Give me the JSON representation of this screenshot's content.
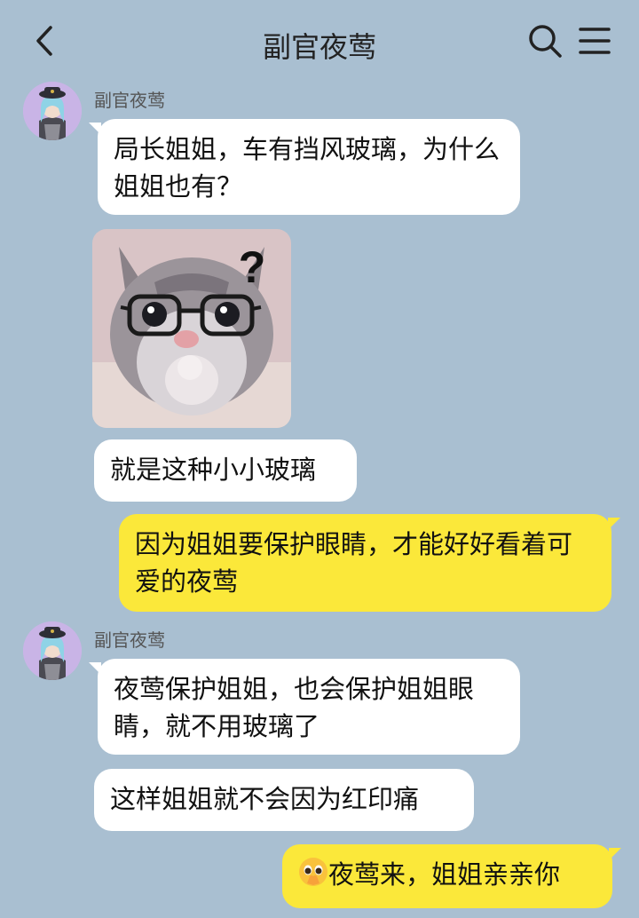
{
  "header": {
    "title": "副官夜莺"
  },
  "messages": [
    {
      "side": "left",
      "sender": "副官夜莺",
      "text": "局长姐姐，车有挡风玻璃，为什么姐姐也有？"
    },
    {
      "side": "left",
      "type": "sticker",
      "sticker_icon": "cat-with-glasses-sticker",
      "sticker_text": "?"
    },
    {
      "side": "left",
      "text": "就是这种小小玻璃"
    },
    {
      "side": "right",
      "text": "因为姐姐要保护眼睛，才能好好看着可爱的夜莺"
    },
    {
      "side": "left",
      "sender": "副官夜莺",
      "text": "夜莺保护姐姐，也会保护姐姐眼睛，就不用玻璃了"
    },
    {
      "side": "left",
      "text": "这样姐姐就不会因为红印痛"
    },
    {
      "side": "right",
      "emoji": "pleading-face-emoji",
      "text": "夜莺来，姐姐亲亲你"
    }
  ],
  "colors": {
    "background": "#a9bfd1",
    "left_bubble": "#ffffff",
    "right_bubble": "#fbe83a",
    "avatar_bg": "#c9b4e6"
  }
}
